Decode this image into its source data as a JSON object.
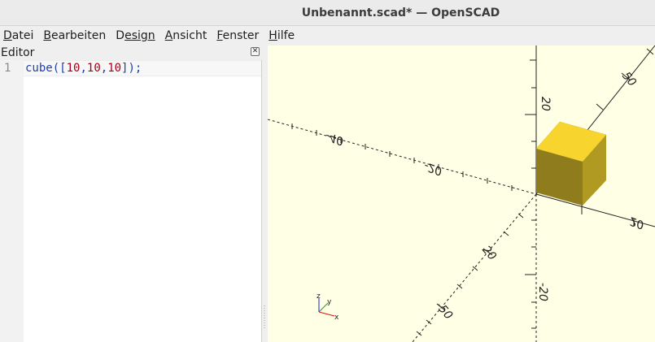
{
  "window": {
    "title": "Unbenannt.scad* — OpenSCAD"
  },
  "menu": [
    {
      "mnemonic": "D",
      "rest": "atei"
    },
    {
      "mnemonic": "B",
      "rest": "earbeiten"
    },
    {
      "mnemonic": "D",
      "rest": "esign"
    },
    {
      "mnemonic": "A",
      "rest": "nsicht"
    },
    {
      "mnemonic": "F",
      "rest": "enster"
    },
    {
      "mnemonic": "H",
      "rest": "ilfe"
    }
  ],
  "editor": {
    "title": "Editor",
    "line_number": "1",
    "code": {
      "fn": "cube(",
      "open": "[",
      "n1": "10",
      "c1": ",",
      "n2": "10",
      "c2": ",",
      "n3": "10",
      "close": "]",
      "end": ");"
    }
  },
  "viewport": {
    "background": "#ffffe5",
    "cube_colors": {
      "top": "#f8d42f",
      "left": "#8f7c1d",
      "right": "#b09a22"
    },
    "axis_labels": [
      "-40",
      "-20",
      "20",
      "20",
      "50",
      "20",
      "-20",
      "-20",
      "-50"
    ],
    "gizmo": {
      "x": "x",
      "y": "y",
      "z": "z"
    }
  }
}
